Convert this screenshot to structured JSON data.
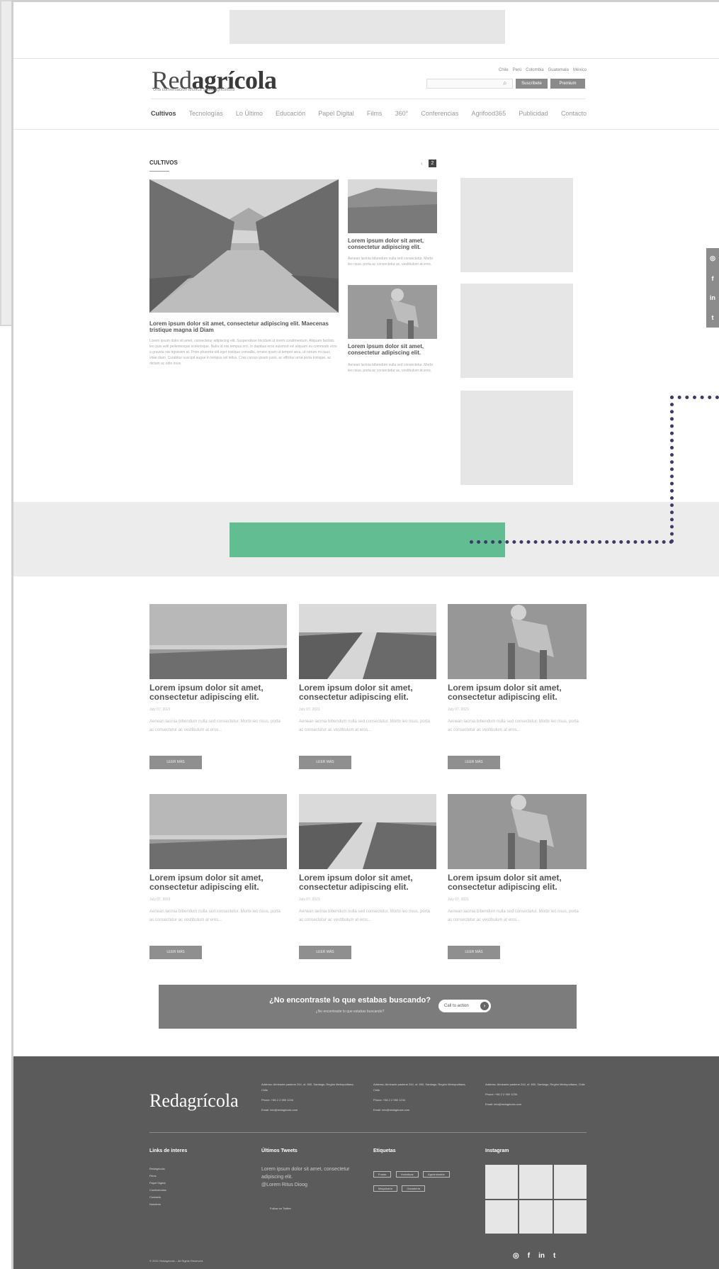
{
  "header": {
    "logo_regular": "Red",
    "logo_bold": "agrícola",
    "tagline": "Una conversación técnica sobre agricultura",
    "utility_links": [
      "Chile",
      "Perú",
      "Colombia",
      "Guatemala",
      "México"
    ],
    "search_placeholder": "",
    "subscribe_label": "Suscríbete",
    "login_label": "Premium"
  },
  "nav": {
    "items": [
      "Cultivos",
      "Tecnologías",
      "Lo Último",
      "Educación",
      "Papel Digital",
      "Films",
      "360°",
      "Conferencias",
      "Agrifood365",
      "Publicidad",
      "Contacto"
    ]
  },
  "cultivos": {
    "title": "CULTIVOS",
    "pager_prev": "‹",
    "pager_current": "2",
    "featured_title": "Lorem ipsum dolor sit amet, consectetur adipiscing elit. Maecenas tristique magna id Diam",
    "featured_excerpt": "Lorem ipsum dolor sit amet, consectetur adipiscing elit. Suspendisse tincidunt ut lorem condimentum. Aliquam facilisis leo quis velit pellentesque scelerisque. Nulla id nisi tempus orci, in dapibus eros euismod vel aliquam eu commodo eros a gravida nisi tignissim at. Proin pharetra elit eget tristique convallis, ornare quam ut tempor arcu, ut rutrum mi risus vitae diam. Curabitur suscipit augue in tempus vel tellus. Cras cursus ipsum justo, ac efficitur urna porta tristique, ac dictum ac odio risus.",
    "side_posts": [
      {
        "title": "Lorem ipsum dolor sit amet, consectetur adipiscing elit.",
        "excerpt": "Aenean lacinia bibendum nulla sed consectetur. Morbi leo risus, porta ac consectetur ac, vestibulum at eros."
      },
      {
        "title": "Lorem ipsum dolor sit amet, consectetur adipiscing elit.",
        "excerpt": "Aenean lacinia bibendum nulla sed consectetur. Morbi leo risus, porta ac consectetur ac, vestibulum at eros."
      }
    ]
  },
  "grid": {
    "posts": [
      {
        "title": "Lorem ipsum dolor sit amet, consectetur adipiscing elit.",
        "date": "July 07, 2021",
        "excerpt": "Aenean lacinia bibendum nulla sed consectetur. Morbi leo risus, porta ac consectetur ac vestibulum at eros...",
        "button": "LEER MÁS"
      },
      {
        "title": "Lorem ipsum dolor sit amet, consectetur adipiscing elit.",
        "date": "July 07, 2021",
        "excerpt": "Aenean lacinia bibendum nulla sed consectetur. Morbi leo risus, porta ac consectetur ac vestibulum at eros...",
        "button": "LEER MÁS"
      },
      {
        "title": "Lorem ipsum dolor sit amet, consectetur adipiscing elit.",
        "date": "July 07, 2021",
        "excerpt": "Aenean lacinia bibendum nulla sed consectetur. Morbi leo risus, porta ac consectetur ac vestibulum at eros...",
        "button": "LEER MÁS"
      },
      {
        "title": "Lorem ipsum dolor sit amet, consectetur adipiscing elit.",
        "date": "July 07, 2021",
        "excerpt": "Aenean lacinia bibendum nulla sed consectetur. Morbi leo risus, porta ac consectetur ac vestibulum at eros...",
        "button": "LEER MÁS"
      },
      {
        "title": "Lorem ipsum dolor sit amet, consectetur adipiscing elit.",
        "date": "July 07, 2021",
        "excerpt": "Aenean lacinia bibendum nulla sed consectetur. Morbi leo risus, porta ac consectetur ac vestibulum at eros...",
        "button": "LEER MÁS"
      },
      {
        "title": "Lorem ipsum dolor sit amet, consectetur adipiscing elit.",
        "date": "July 07, 2021",
        "excerpt": "Aenean lacinia bibendum nulla sed consectetur. Morbi leo risus, porta ac consectetur ac vestibulum at eros...",
        "button": "LEER MÁS"
      }
    ]
  },
  "cta": {
    "title": "¿No encontraste lo que estabas buscando?",
    "subtitle": "¿No encontraste lo que estabas buscando?",
    "button": "Call to action"
  },
  "footer": {
    "logo": "Redagrícola",
    "addresses": [
      {
        "address": "Address: Almirante pastene 244, of. 800, Santiago, Región Metropolitana, Chile",
        "phone": "Phone: +56 2 2 950 1234",
        "email": "Email: info@redagricola.com"
      },
      {
        "address": "Address: Almirante pastene 244, of. 800, Santiago, Región Metropolitana, Chile",
        "phone": "Phone: +56 2 2 950 1234",
        "email": "Email: info@redagricola.com"
      },
      {
        "address": "Address: Almirante pastene 244, of. 800, Santiago, Región Metropolitana, Chile",
        "phone": "Phone: +56 2 2 950 1234",
        "email": "Email: info@redagricola.com"
      }
    ],
    "links_heading": "Links de interes",
    "links": [
      "Redagrícola",
      "Films",
      "Papel Digital",
      "Conferencias",
      "Contacto",
      "Nosotros"
    ],
    "tweets_heading": "Últimos Tweets",
    "tweet_text": "Lorem ipsum dolor sit amet, consectetur adipiscing elit.",
    "tweet_handle": "@Lorem Ritus Dioog",
    "tweet_follow": "Follow on Twitter",
    "tags_heading": "Etiquetas",
    "tags": [
      "Frutas",
      "Hortalizas",
      "Agroindustria",
      "Maquinaria",
      "Ganadería"
    ],
    "instagram_heading": "Instagram",
    "copyright": "© 2021 Redagrícola – All Rights Reserved."
  },
  "colors": {
    "accent_green": "#62bd93",
    "dotted_line": "#3d3a6b",
    "footer_bg": "#5b5b5b"
  }
}
